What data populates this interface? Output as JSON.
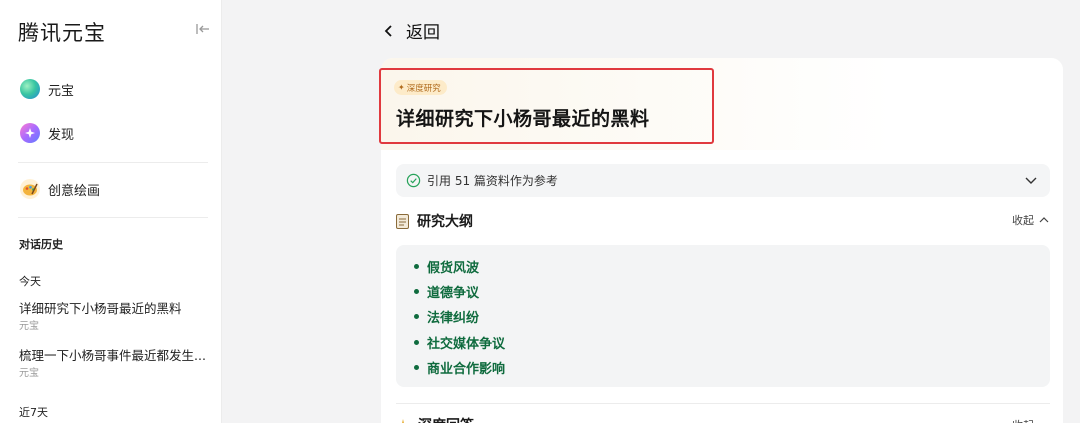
{
  "sidebar": {
    "brand": "腾讯元宝",
    "nav": [
      {
        "label": "元宝",
        "icon": "yuanbao-logo-icon"
      },
      {
        "label": "发现",
        "icon": "discover-icon"
      },
      {
        "label": "创意绘画",
        "icon": "paint-palette-icon"
      }
    ],
    "history_header": "对话历史",
    "groups": [
      {
        "label": "今天",
        "items": [
          {
            "title": "详细研究下小杨哥最近的黑料",
            "source": "元宝"
          },
          {
            "title": "梳理一下小杨哥事件最近都发生...",
            "source": "元宝"
          }
        ]
      },
      {
        "label": "近7天",
        "items": []
      }
    ]
  },
  "main": {
    "back_label": "返回",
    "tag": "深度研究",
    "title": "详细研究下小杨哥最近的黑料",
    "references": "引用 51 篇资料作为参考",
    "outline": {
      "title": "研究大纲",
      "collapse_label": "收起",
      "items": [
        "假货风波",
        "道德争议",
        "法律纠纷",
        "社交媒体争议",
        "商业合作影响"
      ]
    },
    "next_section": {
      "title": "深度回答",
      "right_label": "收起"
    }
  },
  "colors": {
    "highlight_border": "#e0393e",
    "outline_text": "#0f6b3e",
    "tag_bg": "#fdebc9",
    "tag_text": "#b06a1c"
  }
}
